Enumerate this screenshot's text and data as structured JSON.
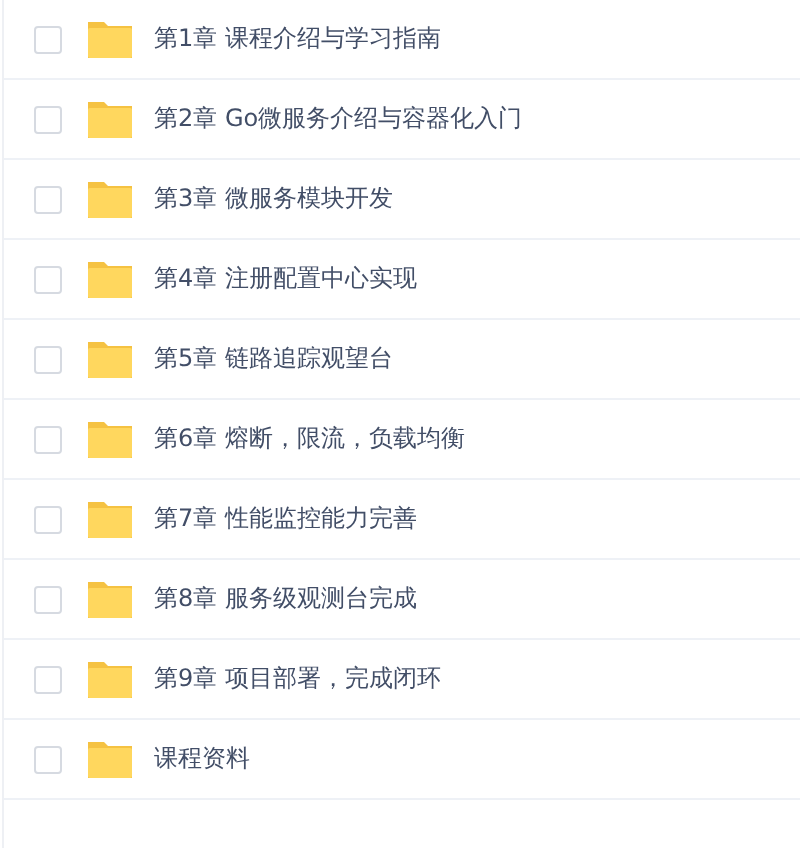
{
  "folders": [
    {
      "name": "第1章 课程介绍与学习指南",
      "checked": false
    },
    {
      "name": "第2章 Go微服务介绍与容器化入门",
      "checked": false
    },
    {
      "name": "第3章 微服务模块开发",
      "checked": false
    },
    {
      "name": "第4章 注册配置中心实现",
      "checked": false
    },
    {
      "name": "第5章 链路追踪观望台",
      "checked": false
    },
    {
      "name": "第6章 熔断，限流，负载均衡",
      "checked": false
    },
    {
      "name": "第7章 性能监控能力完善",
      "checked": false
    },
    {
      "name": "第8章 服务级观测台完成",
      "checked": false
    },
    {
      "name": "第9章 项目部署，完成闭环",
      "checked": false
    },
    {
      "name": "课程资料",
      "checked": false
    }
  ]
}
